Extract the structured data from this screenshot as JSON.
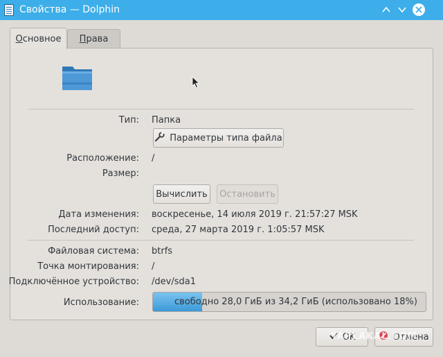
{
  "window": {
    "title": "Свойства — Dolphin",
    "title_bar_color": "#3daee9",
    "controls": [
      "chevron-up-icon",
      "chevron-down-icon",
      "close-icon"
    ]
  },
  "tabs": [
    {
      "label_underlined": "О",
      "label_rest": "сновное",
      "active": true
    },
    {
      "label_underlined": "П",
      "label_rest": "рава",
      "active": false
    }
  ],
  "general": {
    "icon": "folder-icon",
    "type_label": "Тип:",
    "type_value": "Папка",
    "file_type_options_button": "Параметры типа файла",
    "location_label": "Расположение:",
    "location_value": "/",
    "size_label": "Размер:",
    "size_value": "",
    "calculate_button": "Вычислить",
    "stop_button": "Остановить",
    "modified_label": "Дата изменения:",
    "modified_value": "воскресенье, 14 июля 2019 г. 21:57:27 MSK",
    "accessed_label": "Последний доступ:",
    "accessed_value": "среда, 27 марта 2019 г. 1:05:57 MSK",
    "filesystem_label": "Файловая система:",
    "filesystem_value": "btrfs",
    "mount_point_label": "Точка монтирования:",
    "mount_point_value": "/",
    "device_label": "Подключённое устройство:",
    "device_value": "/dev/sda1",
    "usage_label": "Использование:",
    "usage_text": "свободно 28,0 ГиБ из 34,2 ГиБ (использовано 18%)",
    "usage_fraction": 0.18,
    "usage_color": "#3b9ad9"
  },
  "footer": {
    "ok_button": "OK",
    "cancel_button": "Отмена"
  },
  "watermark": "YAPLAKAL.COM"
}
